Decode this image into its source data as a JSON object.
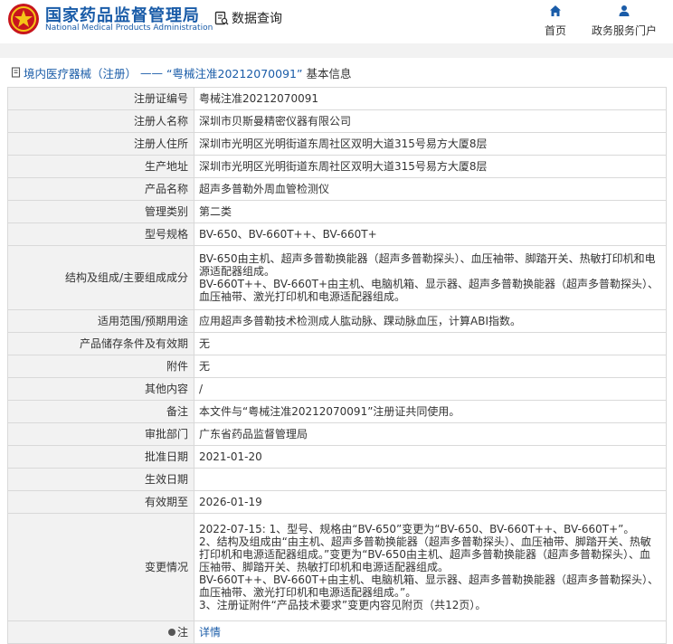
{
  "header": {
    "brand_cn": "国家药品监督管理局",
    "brand_en": "National Medical Products Administration",
    "query_label": "数据查询",
    "nav": [
      {
        "label": "首页",
        "icon": "home-icon"
      },
      {
        "label": "政务服务门户",
        "icon": "user-icon"
      }
    ]
  },
  "breadcrumb": {
    "category": "境内医疗器械（注册）",
    "separator": "——",
    "item": "“粤械注准20212070091”",
    "suffix": "基本信息"
  },
  "details": [
    {
      "key": "注册证编号",
      "value": [
        "粤械注准20212070091"
      ]
    },
    {
      "key": "注册人名称",
      "value": [
        "深圳市贝斯曼精密仪器有限公司"
      ]
    },
    {
      "key": "注册人住所",
      "value": [
        "深圳市光明区光明街道东周社区双明大道315号易方大厦8层"
      ]
    },
    {
      "key": "生产地址",
      "value": [
        "深圳市光明区光明街道东周社区双明大道315号易方大厦8层"
      ]
    },
    {
      "key": "产品名称",
      "value": [
        "超声多普勒外周血管检测仪"
      ]
    },
    {
      "key": "管理类别",
      "value": [
        "第二类"
      ]
    },
    {
      "key": "型号规格",
      "value": [
        "BV-650、BV-660T++、BV-660T+"
      ]
    },
    {
      "key": "结构及组成/主要组成成分",
      "value": [
        "BV-650由主机、超声多普勒换能器（超声多普勒探头）、血压袖带、脚踏开关、热敏打印机和电源适配器组成。",
        "BV-660T++、BV-660T+由主机、电脑机箱、显示器、超声多普勒换能器（超声多普勒探头）、血压袖带、激光打印机和电源适配器组成。"
      ]
    },
    {
      "key": "适用范围/预期用途",
      "value": [
        "应用超声多普勒技术检测成人肱动脉、踝动脉血压，计算ABI指数。"
      ]
    },
    {
      "key": "产品储存条件及有效期",
      "value": [
        "无"
      ]
    },
    {
      "key": "附件",
      "value": [
        "无"
      ]
    },
    {
      "key": "其他内容",
      "value": [
        "/"
      ]
    },
    {
      "key": "备注",
      "value": [
        "本文件与“粤械注准20212070091”注册证共同使用。"
      ]
    },
    {
      "key": "审批部门",
      "value": [
        "广东省药品监督管理局"
      ]
    },
    {
      "key": "批准日期",
      "value": [
        "2021-01-20"
      ]
    },
    {
      "key": "生效日期",
      "value": [
        ""
      ]
    },
    {
      "key": "有效期至",
      "value": [
        "2026-01-19"
      ]
    },
    {
      "key": "变更情况",
      "value": [
        "2022-07-15: 1、型号、规格由“BV-650”变更为“BV-650、BV-660T++、BV-660T+”。",
        "2、结构及组成由“由主机、超声多普勒换能器（超声多普勒探头）、血压袖带、脚踏开关、热敏打印机和电源适配器组成。”变更为“BV-650由主机、超声多普勒换能器（超声多普勒探头）、血压袖带、脚踏开关、热敏打印机和电源适配器组成。",
        "BV-660T++、BV-660T+由主机、电脑机箱、显示器、超声多普勒换能器（超声多普勒探头）、血压袖带、激光打印机和电源适配器组成。”。",
        "3、注册证附件“产品技术要求”变更内容见附页（共12页）。"
      ]
    }
  ],
  "note": {
    "key": "注",
    "link": "详情"
  },
  "colors": {
    "brand": "#1a5ca8",
    "key_bg": "#f2f2f2",
    "border": "#d9d9d9"
  }
}
